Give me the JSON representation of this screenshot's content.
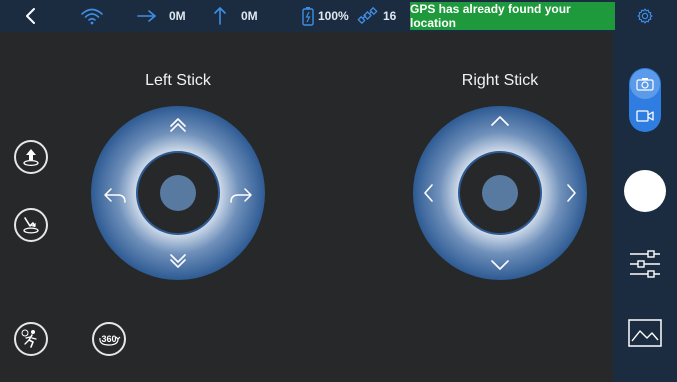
{
  "status_bar": {
    "back_icon": "chevron-left-icon",
    "wifi_icon": "wifi-icon",
    "horizontal_distance": "0M",
    "vertical_distance": "0M",
    "battery_percent": "100%",
    "satellite_count": "16",
    "gps_message": "GPS has already found your location",
    "settings_icon": "gear-icon",
    "colors": {
      "bar": "#1b2c40",
      "accent": "#3f8ee6",
      "gps_banner": "#1e9a3c"
    }
  },
  "left_stick": {
    "title": "Left Stick",
    "up_icon": "double-chevron-up-icon",
    "down_icon": "double-chevron-down-icon",
    "left_icon": "rotate-left-icon",
    "right_icon": "rotate-right-icon"
  },
  "right_stick": {
    "title": "Right Stick",
    "up_icon": "chevron-up-icon",
    "down_icon": "chevron-down-icon",
    "left_icon": "chevron-left-icon",
    "right_icon": "chevron-right-icon"
  },
  "left_buttons": [
    {
      "name": "takeoff-button",
      "icon": "takeoff-icon"
    },
    {
      "name": "land-button",
      "icon": "land-icon"
    },
    {
      "name": "follow-me-button",
      "icon": "follow-me-icon"
    },
    {
      "name": "rotate-360-button",
      "icon": "rotate-360-icon",
      "label": "360"
    }
  ],
  "right_panel": {
    "photo_icon": "camera-icon",
    "video_icon": "video-icon",
    "shutter": "shutter-button",
    "settings_icon": "sliders-icon",
    "gallery_icon": "gallery-icon"
  }
}
